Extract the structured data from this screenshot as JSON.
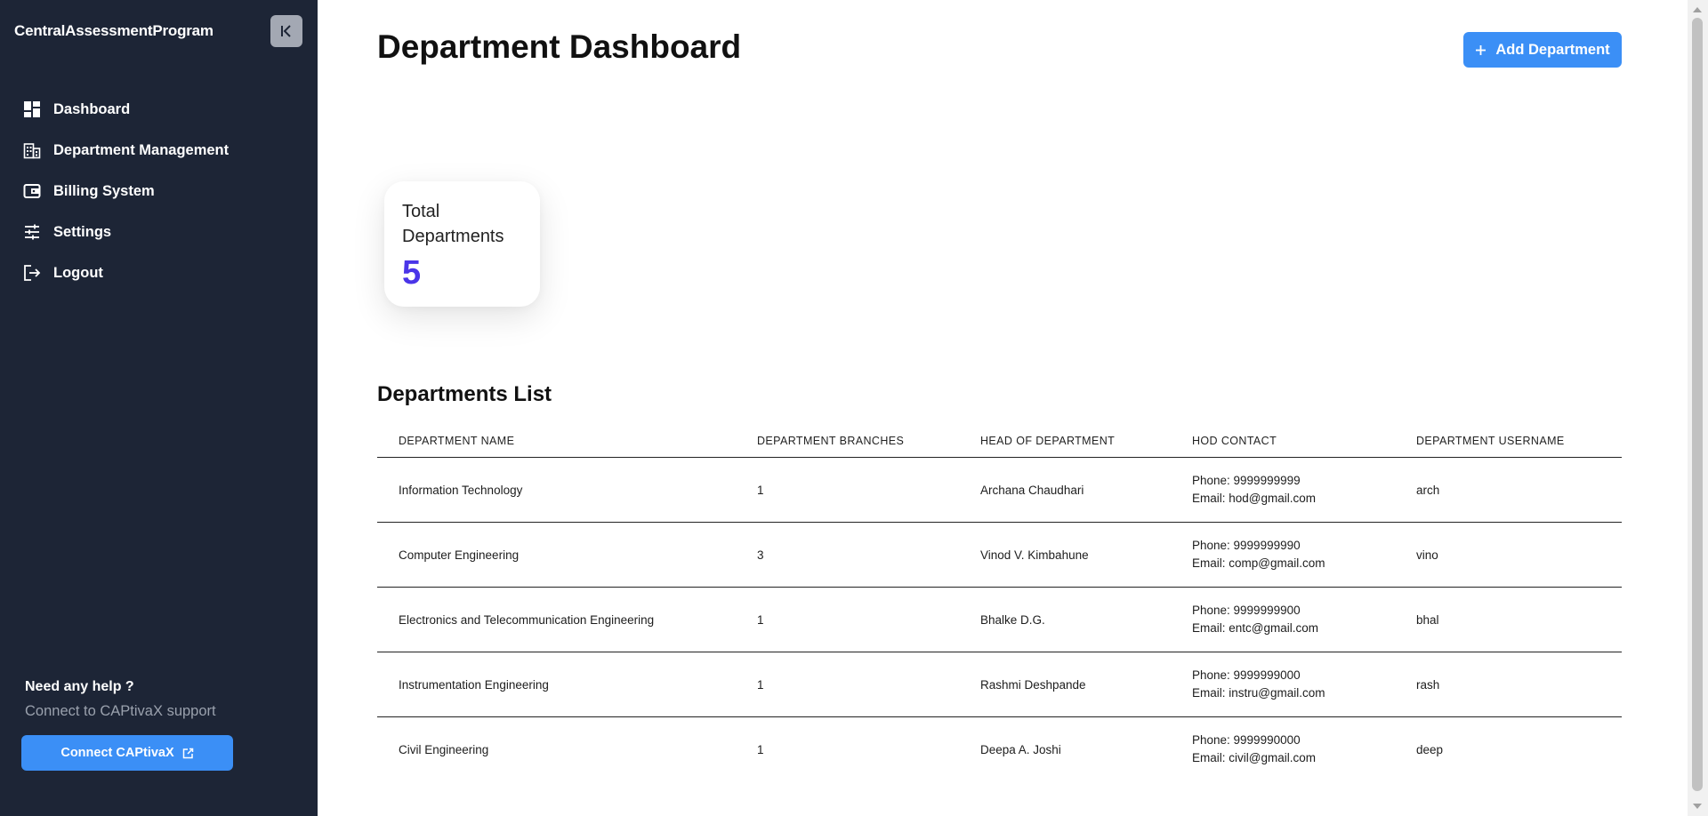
{
  "sidebar": {
    "brand": "CentralAssessmentProgram",
    "nav": [
      {
        "label": "Dashboard",
        "icon": "dashboard-icon"
      },
      {
        "label": "Department Management",
        "icon": "building-icon"
      },
      {
        "label": "Billing System",
        "icon": "wallet-icon"
      },
      {
        "label": "Settings",
        "icon": "sliders-icon"
      },
      {
        "label": "Logout",
        "icon": "logout-icon"
      }
    ],
    "help_title": "Need any help ?",
    "help_sub": "Connect to CAPtivaX support",
    "connect_label": "Connect CAPtivaX"
  },
  "main": {
    "title": "Department Dashboard",
    "add_label": "Add Department",
    "stat": {
      "label": "Total Departments",
      "value": "5"
    },
    "list_title": "Departments List",
    "columns": [
      "DEPARTMENT NAME",
      "DEPARTMENT BRANCHES",
      "HEAD OF DEPARTMENT",
      "HOD CONTACT",
      "DEPARTMENT USERNAME"
    ],
    "rows": [
      {
        "name": "Information Technology",
        "branches": "1",
        "hod": "Archana Chaudhari",
        "phone": "Phone: 9999999999",
        "email": "Email: hod@gmail.com",
        "username": "arch"
      },
      {
        "name": "Computer Engineering",
        "branches": "3",
        "hod": "Vinod V. Kimbahune",
        "phone": "Phone: 9999999990",
        "email": "Email: comp@gmail.com",
        "username": "vino"
      },
      {
        "name": "Electronics and Telecommunication Engineering",
        "branches": "1",
        "hod": "Bhalke D.G.",
        "phone": "Phone: 9999999900",
        "email": "Email: entc@gmail.com",
        "username": "bhal"
      },
      {
        "name": "Instrumentation Engineering",
        "branches": "1",
        "hod": "Rashmi Deshpande",
        "phone": "Phone: 9999999000",
        "email": "Email: instru@gmail.com",
        "username": "rash"
      },
      {
        "name": "Civil Engineering",
        "branches": "1",
        "hod": "Deepa A. Joshi",
        "phone": "Phone: 9999990000",
        "email": "Email: civil@gmail.com",
        "username": "deep"
      }
    ]
  },
  "colors": {
    "sidebar_bg": "#1d2536",
    "accent": "#3b8ff6",
    "stat_value": "#4a35e8"
  }
}
